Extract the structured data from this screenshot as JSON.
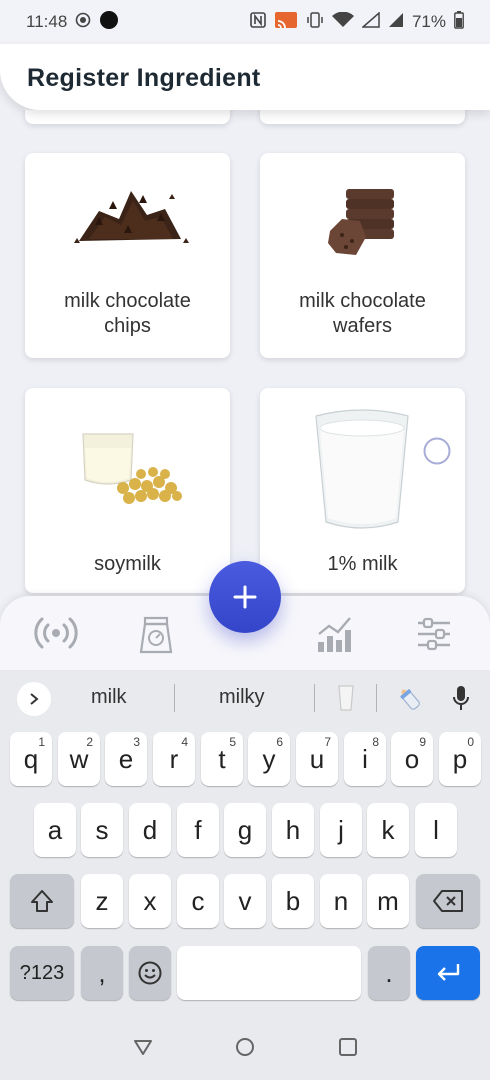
{
  "status_bar": {
    "time": "11:48",
    "battery": "71%"
  },
  "header": {
    "title": "Register Ingredient"
  },
  "ingredients": [
    {
      "name": "milk chocolate chips",
      "icon": "chocolate-chips-image"
    },
    {
      "name": "milk chocolate wafers",
      "icon": "chocolate-wafers-image"
    },
    {
      "name": "soymilk",
      "icon": "soymilk-image"
    },
    {
      "name": "1% milk",
      "icon": "milk-glass-image"
    }
  ],
  "bottom_nav": {
    "items": [
      "broadcast-icon",
      "scale-icon",
      "chart-icon",
      "sliders-icon"
    ],
    "fab_label": "+"
  },
  "keyboard": {
    "suggestions": [
      "milk",
      "milky"
    ],
    "rows": [
      [
        {
          "k": "q",
          "h": "1"
        },
        {
          "k": "w",
          "h": "2"
        },
        {
          "k": "e",
          "h": "3"
        },
        {
          "k": "r",
          "h": "4"
        },
        {
          "k": "t",
          "h": "5"
        },
        {
          "k": "y",
          "h": "6"
        },
        {
          "k": "u",
          "h": "7"
        },
        {
          "k": "i",
          "h": "8"
        },
        {
          "k": "o",
          "h": "9"
        },
        {
          "k": "p",
          "h": "0"
        }
      ],
      [
        {
          "k": "a"
        },
        {
          "k": "s"
        },
        {
          "k": "d"
        },
        {
          "k": "f"
        },
        {
          "k": "g"
        },
        {
          "k": "h"
        },
        {
          "k": "j"
        },
        {
          "k": "k"
        },
        {
          "k": "l"
        }
      ],
      [
        {
          "k": "z"
        },
        {
          "k": "x"
        },
        {
          "k": "c"
        },
        {
          "k": "v"
        },
        {
          "k": "b"
        },
        {
          "k": "n"
        },
        {
          "k": "m"
        }
      ]
    ],
    "symbols_label": "?123",
    "comma_label": ",",
    "period_label": ".",
    "enter_color": "#1a73e8"
  }
}
